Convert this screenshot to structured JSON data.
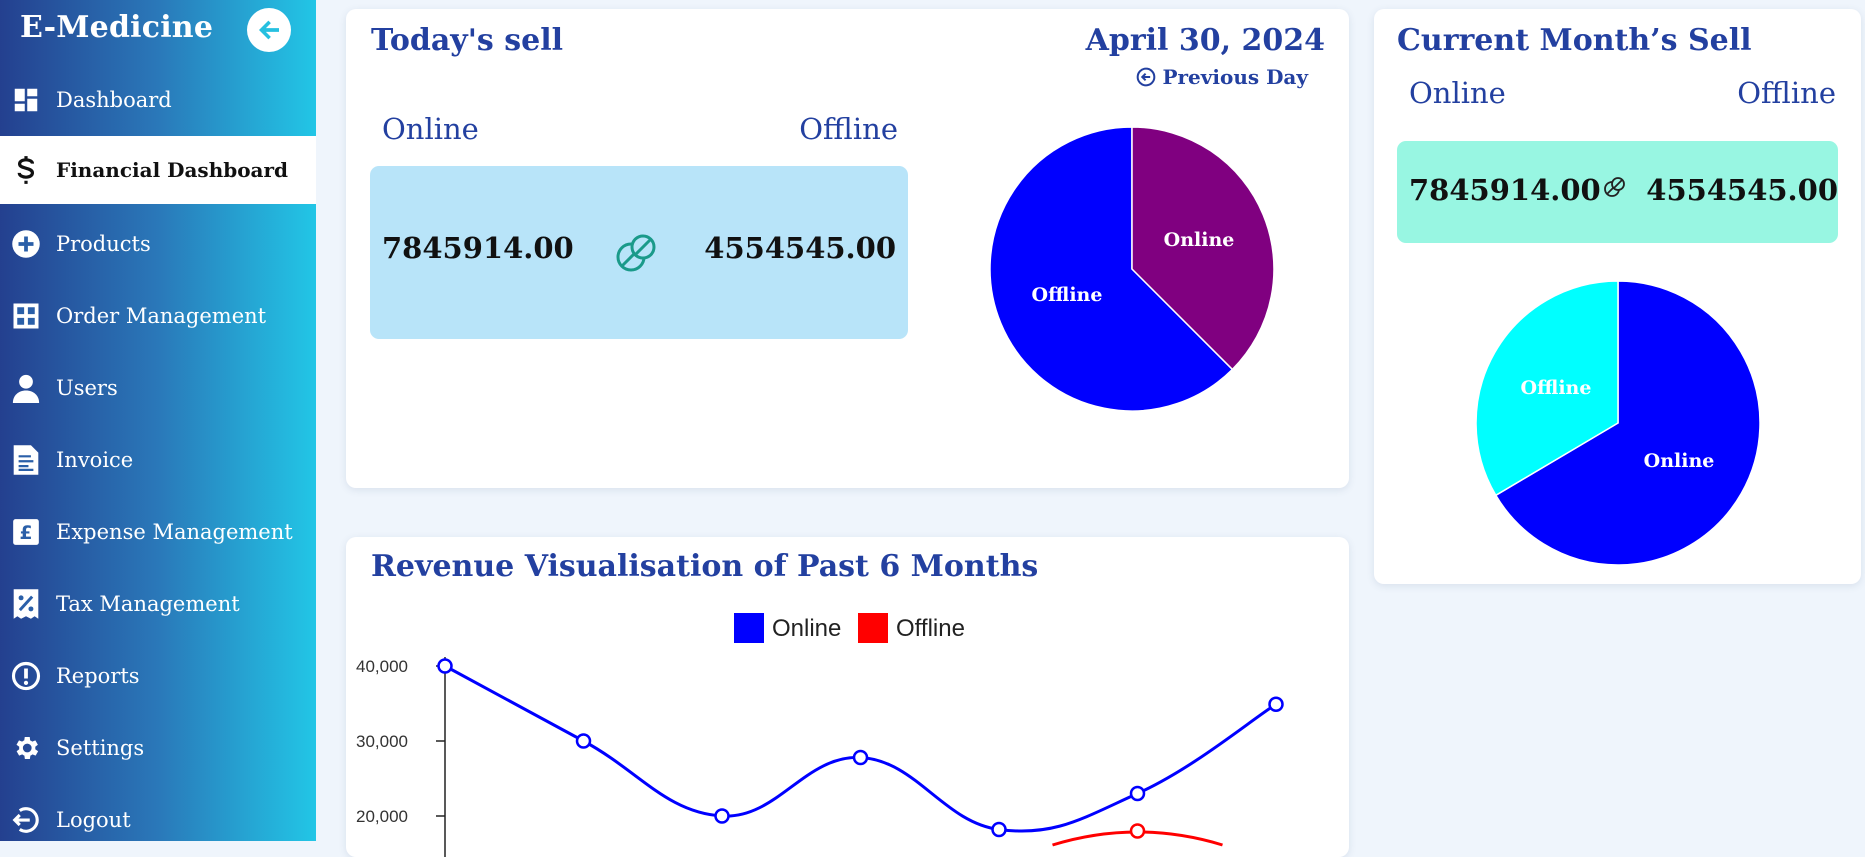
{
  "sidebar": {
    "brand": "E-Medicine",
    "items": [
      {
        "label": "Dashboard",
        "icon": "dashboard-icon"
      },
      {
        "label": "Financial Dashboard",
        "icon": "dollar-icon",
        "active": true
      },
      {
        "label": "Products",
        "icon": "plus-circle-icon"
      },
      {
        "label": "Order Management",
        "icon": "grid-icon"
      },
      {
        "label": "Users",
        "icon": "user-icon"
      },
      {
        "label": "Invoice",
        "icon": "invoice-icon"
      },
      {
        "label": "Expense Management",
        "icon": "pound-icon"
      },
      {
        "label": "Tax Management",
        "icon": "tax-icon"
      },
      {
        "label": "Reports",
        "icon": "alert-circle-icon"
      },
      {
        "label": "Settings",
        "icon": "gear-icon"
      },
      {
        "label": "Logout",
        "icon": "logout-icon"
      }
    ]
  },
  "today": {
    "title": "Today's sell",
    "date": "April 30, 2024",
    "prev_day": "Previous Day",
    "online_label": "Online",
    "offline_label": "Offline",
    "online_value": "7845914.00",
    "offline_value": "4554545.00",
    "pie": {
      "slice_labels": [
        "Online",
        "Offline"
      ],
      "values": [
        38,
        62
      ],
      "colors": [
        "#800080",
        "#0000ff"
      ]
    }
  },
  "month": {
    "title": "Current Month’s Sell",
    "online_label": "Online",
    "offline_label": "Offline",
    "online_value": "7845914.00",
    "offline_value": "4554545.00",
    "pie": {
      "slice_labels": [
        "Online",
        "Offline"
      ],
      "values": [
        67,
        33
      ],
      "colors": [
        "#0000ff",
        "#00ffff"
      ]
    }
  },
  "revenue": {
    "title": "Revenue Visualisation of Past 6 Months"
  },
  "chart_data": {
    "type": "line",
    "title": "Revenue Visualisation of Past 6 Months",
    "legend": "top-center",
    "y_ticks": [
      "40,000",
      "30,000",
      "20,000"
    ],
    "ylim": [
      18000,
      40000
    ],
    "series": [
      {
        "name": "Online",
        "color": "#0000ff",
        "values": [
          40000,
          30000,
          20000,
          27800,
          18200,
          23000,
          34900
        ]
      },
      {
        "name": "Offline",
        "color": "#ff0000",
        "values": [
          null,
          null,
          null,
          null,
          null,
          18000,
          null
        ]
      }
    ]
  }
}
